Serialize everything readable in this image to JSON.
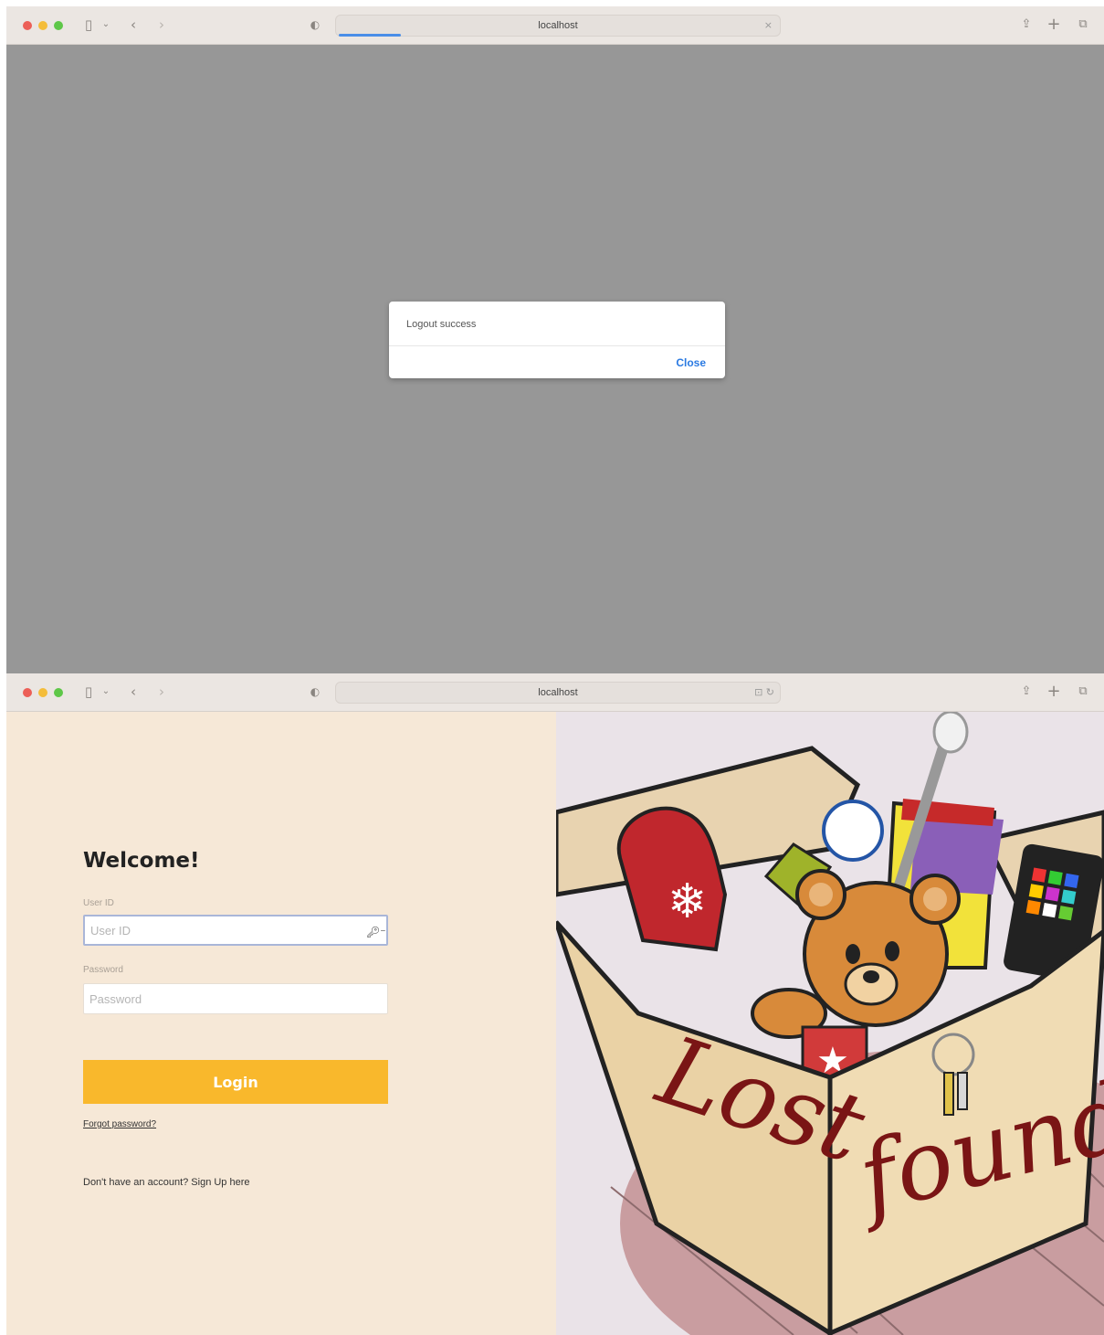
{
  "screen1": {
    "browser": {
      "url": "localhost",
      "stop_icon": "×"
    },
    "dialog": {
      "message": "Logout success",
      "close_label": "Close"
    }
  },
  "screen2": {
    "browser": {
      "url": "localhost",
      "reader_icon": "⊡ ↻"
    },
    "login": {
      "title": "Welcome!",
      "userid_label": "User ID",
      "userid_placeholder": "User ID",
      "password_label": "Password",
      "password_placeholder": "Password",
      "login_button": "Login",
      "forgot_password": "Forgot password?",
      "signup_text": "Don't have an account? Sign Up here"
    },
    "illustration": {
      "word1": "Lost",
      "word2": "found"
    }
  },
  "colors": {
    "overlay": "#979797",
    "accent_button": "#f9b82c",
    "link_blue": "#2a7ae2",
    "left_panel_bg": "#f6e8d7"
  }
}
